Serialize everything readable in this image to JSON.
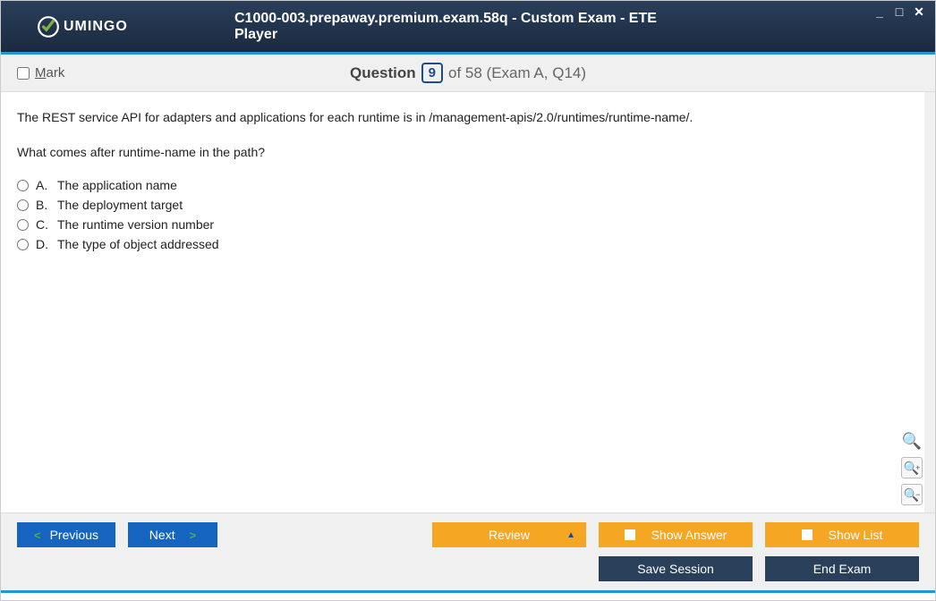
{
  "app": {
    "brand": "UMINGO",
    "title": "C1000-003.prepaway.premium.exam.58q - Custom Exam - ETE Player"
  },
  "questionBar": {
    "mark_label": "ark",
    "mark_prefix": "M",
    "question_label": "Question",
    "current_number": "9",
    "suffix": "of 58 (Exam A, Q14)"
  },
  "question": {
    "line1": "The REST service API for adapters and applications for each runtime is in /management-apis/2.0/runtimes/runtime-name/.",
    "line2": "What comes after runtime-name in the path?",
    "options": [
      {
        "letter": "A.",
        "text": "The application name"
      },
      {
        "letter": "B.",
        "text": "The deployment target"
      },
      {
        "letter": "C.",
        "text": "The runtime version number"
      },
      {
        "letter": "D.",
        "text": "The type of object addressed"
      }
    ]
  },
  "footer": {
    "previous": "Previous",
    "next": "Next",
    "review": "Review",
    "show_answer": "Show Answer",
    "show_list": "Show List",
    "save_session": "Save Session",
    "end_exam": "End Exam"
  }
}
